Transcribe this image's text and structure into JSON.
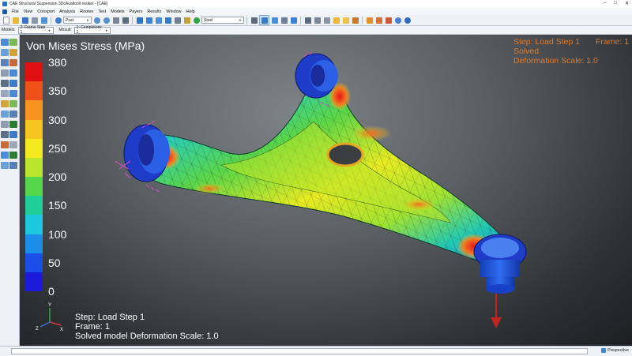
{
  "window": {
    "title": "CAE Structural Suspension 3DcAualtoolt resiker - [CAE]",
    "buttons": [
      "–",
      "□",
      "✕"
    ]
  },
  "menu": [
    "File",
    "View",
    "Consport",
    "Analysis",
    "Rootes",
    "Test",
    "Models",
    "Payers",
    "Results",
    "Window",
    "Help"
  ],
  "toolbar": {
    "view_combo": "Pust",
    "material_combo": "Steel"
  },
  "context": {
    "models_label": "Models:",
    "models_value": "2: Frame Step 1",
    "mosult_label": "Mosult:",
    "mosult_value": "1: Completom: 1"
  },
  "legend": {
    "title": "Von Mises Stress (MPa)",
    "ticks": [
      "380",
      "350",
      "300",
      "250",
      "200",
      "150",
      "100",
      "50",
      "0"
    ],
    "colors": [
      "#e01010",
      "#f0501a",
      "#f7941f",
      "#f7c51f",
      "#f2ea1e",
      "#b8e62a",
      "#55d64b",
      "#1fcf9a",
      "#1cc8e0",
      "#1a8ee8",
      "#1a4ee6",
      "#1c1ad9"
    ]
  },
  "top_info": {
    "step": "Step: Load Step 1",
    "frame": "Frame: 1",
    "status": "Solved",
    "deformation": "Deformation Scale: 1.0"
  },
  "bottom_info": {
    "step": "Step: Load Step 1",
    "frame": "Frame: 1",
    "solved": "Solved model  Deformation Scale: 1.0"
  },
  "triad": {
    "x": "X",
    "y": "Y",
    "z": "Z"
  },
  "status": {
    "view_mode": "Pospective"
  },
  "colors": {
    "accent": "#e07a2a",
    "load_arrow": "#c0261e"
  }
}
